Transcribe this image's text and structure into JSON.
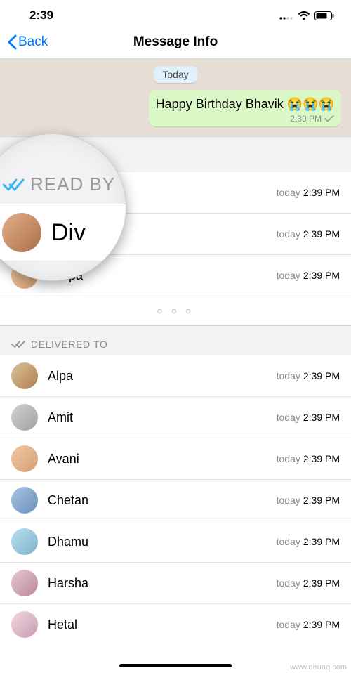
{
  "status": {
    "time": "2:39"
  },
  "nav": {
    "back": "Back",
    "title": "Message Info"
  },
  "chat": {
    "date_label": "Today",
    "bubble_text": "Happy Birthday Bhavik 😭😭😭",
    "bubble_time": "2:39 PM"
  },
  "sections": {
    "read_by_label": "READ BY",
    "delivered_to_label": "DELIVERED TO"
  },
  "read_by": [
    {
      "name": "",
      "today": "today",
      "time": "2:39 PM"
    },
    {
      "name": "",
      "today": "today",
      "time": "2:39 PM"
    },
    {
      "name": "Shilpa",
      "today": "today",
      "time": "2:39 PM"
    }
  ],
  "delivered_to": [
    {
      "name": "Alpa",
      "today": "today",
      "time": "2:39 PM"
    },
    {
      "name": "Amit",
      "today": "today",
      "time": "2:39 PM"
    },
    {
      "name": "Avani",
      "today": "today",
      "time": "2:39 PM"
    },
    {
      "name": "Chetan",
      "today": "today",
      "time": "2:39 PM"
    },
    {
      "name": "Dhamu",
      "today": "today",
      "time": "2:39 PM"
    },
    {
      "name": "Harsha",
      "today": "today",
      "time": "2:39 PM"
    },
    {
      "name": "Hetal",
      "today": "today",
      "time": "2:39 PM"
    }
  ],
  "magnifier": {
    "label": "READ BY",
    "name_fragment": "Div"
  },
  "more_dots": "○ ○ ○",
  "watermark": "www.deuaq.com"
}
